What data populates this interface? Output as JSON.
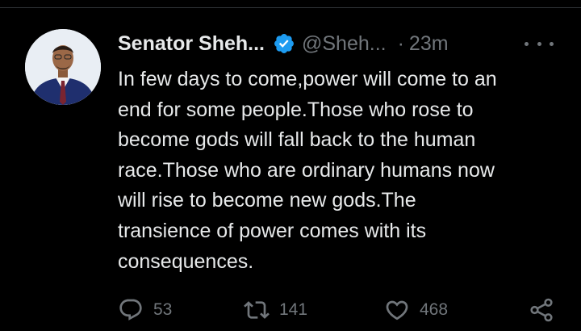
{
  "tweet": {
    "author": {
      "display_name": "Senator Sheh...",
      "handle": "@Sheh...",
      "verified": true
    },
    "separator": "·",
    "timestamp": "23m",
    "lines": [
      "In few days to come,power will come to an",
      "end for some people.Those who rose to",
      "become gods will fall back to the human",
      "race.Those who are ordinary humans now",
      "will rise to become new gods.The",
      "transience of power comes with its",
      "consequences."
    ],
    "metrics": {
      "replies": "53",
      "retweets": "141",
      "likes": "468"
    }
  },
  "icons": {
    "verified": "verified-badge-icon",
    "more": "more-horizontal-icon",
    "reply": "reply-icon",
    "retweet": "retweet-icon",
    "like": "heart-icon",
    "share": "share-icon"
  },
  "colors": {
    "background": "#000000",
    "text": "#e7e9ea",
    "secondary": "#71767b",
    "verified": "#1d9bf0"
  }
}
